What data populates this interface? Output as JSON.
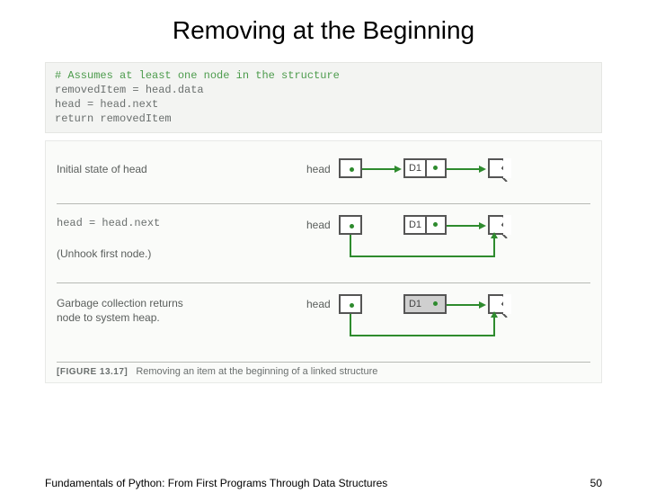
{
  "title": "Removing at the Beginning",
  "code": {
    "comment": "# Assumes at least one node in the structure",
    "line1": "removedItem = head.data",
    "line2": "head = head.next",
    "line3": "return removedItem"
  },
  "diagram": {
    "row1": {
      "desc": "Initial state of head",
      "head": "head",
      "d1": "D1"
    },
    "row2": {
      "code": "head = head.next",
      "note": "(Unhook first node.)",
      "head": "head",
      "d1": "D1"
    },
    "row3": {
      "desc": "Garbage collection returns node to system heap.",
      "head": "head",
      "d1": "D1"
    }
  },
  "caption": {
    "figno": "[FIGURE 13.17]",
    "text": "Removing an item at the beginning of a linked structure"
  },
  "footer": {
    "book": "Fundamentals of Python: From First Programs Through Data Structures",
    "page": "50"
  }
}
